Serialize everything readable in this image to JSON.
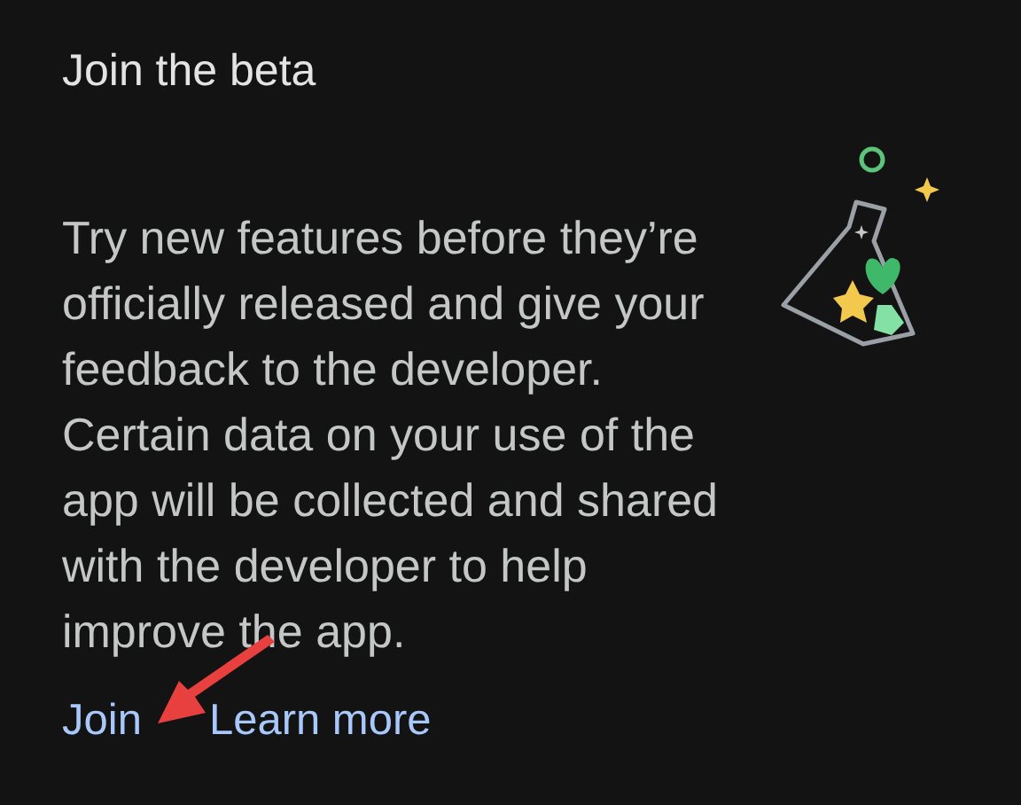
{
  "title": "Join the beta",
  "description": "Try new features before they’re officially released and give your feedback to the developer. Certain data on your use of the app will be collected and shared with the developer to help improve the app.",
  "links": [
    "Join",
    "Learn more"
  ]
}
